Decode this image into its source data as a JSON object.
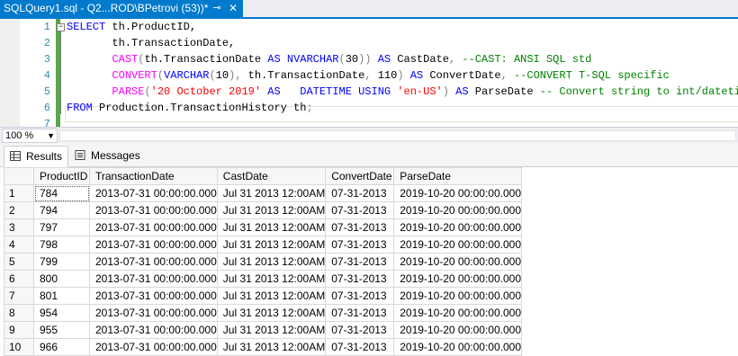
{
  "document_tab": {
    "title": "SQLQuery1.sql - Q2...ROD\\BPetrovi (53))*",
    "pin": "⊸",
    "close": "✕"
  },
  "editor": {
    "lines": [
      {
        "number": "1",
        "tokens": [
          {
            "t": "SELECT",
            "c": "kw"
          },
          {
            "t": " th.ProductID,",
            "c": "tx"
          }
        ]
      },
      {
        "number": "2",
        "tokens": [
          {
            "t": "       th.TransactionDate,",
            "c": "tx"
          }
        ]
      },
      {
        "number": "3",
        "tokens": [
          {
            "t": "       ",
            "c": "tx"
          },
          {
            "t": "CAST",
            "c": "fn"
          },
          {
            "t": "(",
            "c": "gy"
          },
          {
            "t": "th.TransactionDate ",
            "c": "tx"
          },
          {
            "t": "AS NVARCHAR",
            "c": "kw"
          },
          {
            "t": "(",
            "c": "gy"
          },
          {
            "t": "30",
            "c": "tx"
          },
          {
            "t": "))",
            "c": "gy"
          },
          {
            "t": " ",
            "c": "tx"
          },
          {
            "t": "AS",
            "c": "kw"
          },
          {
            "t": " CastDate",
            "c": "tx"
          },
          {
            "t": ", ",
            "c": "gy"
          },
          {
            "t": "--CAST: ANSI SQL std",
            "c": "cm"
          }
        ]
      },
      {
        "number": "4",
        "tokens": [
          {
            "t": "       ",
            "c": "tx"
          },
          {
            "t": "CONVERT",
            "c": "fn"
          },
          {
            "t": "(",
            "c": "gy"
          },
          {
            "t": "VARCHAR",
            "c": "kw"
          },
          {
            "t": "(",
            "c": "gy"
          },
          {
            "t": "10",
            "c": "tx"
          },
          {
            "t": "),",
            "c": "gy"
          },
          {
            "t": " th.TransactionDate",
            "c": "tx"
          },
          {
            "t": ",",
            "c": "gy"
          },
          {
            "t": " 110",
            "c": "tx"
          },
          {
            "t": ")",
            "c": "gy"
          },
          {
            "t": " ",
            "c": "tx"
          },
          {
            "t": "AS",
            "c": "kw"
          },
          {
            "t": " ConvertDate",
            "c": "tx"
          },
          {
            "t": ", ",
            "c": "gy"
          },
          {
            "t": "--CONVERT T-SQL specific",
            "c": "cm"
          }
        ]
      },
      {
        "number": "5",
        "tokens": [
          {
            "t": "       ",
            "c": "tx"
          },
          {
            "t": "PARSE",
            "c": "fn"
          },
          {
            "t": "(",
            "c": "gy"
          },
          {
            "t": "'20 October 2019'",
            "c": "str"
          },
          {
            "t": " ",
            "c": "tx"
          },
          {
            "t": "AS",
            "c": "kw"
          },
          {
            "t": "   ",
            "c": "tx"
          },
          {
            "t": "DATETIME USING",
            "c": "kw"
          },
          {
            "t": " ",
            "c": "tx"
          },
          {
            "t": "'en-US'",
            "c": "str"
          },
          {
            "t": ")",
            "c": "gy"
          },
          {
            "t": " ",
            "c": "tx"
          },
          {
            "t": "AS",
            "c": "kw"
          },
          {
            "t": " ParseDate ",
            "c": "tx"
          },
          {
            "t": "-- Convert string to int/datetime",
            "c": "cm"
          }
        ]
      },
      {
        "number": "6",
        "tokens": [
          {
            "t": "FROM",
            "c": "kw"
          },
          {
            "t": " Production.TransactionHistory th",
            "c": "tx"
          },
          {
            "t": ";",
            "c": "gy"
          }
        ]
      },
      {
        "number": "7",
        "tokens": []
      }
    ]
  },
  "zoom": {
    "value": "100 %"
  },
  "results_tabs": [
    {
      "label": "Results",
      "icon": "grid-icon"
    },
    {
      "label": "Messages",
      "icon": "messages-icon"
    }
  ],
  "grid": {
    "columns": [
      "ProductID",
      "TransactionDate",
      "CastDate",
      "ConvertDate",
      "ParseDate"
    ],
    "rows": [
      [
        "1",
        "784",
        "2013-07-31 00:00:00.000",
        "Jul 31 2013 12:00AM",
        "07-31-2013",
        "2019-10-20 00:00:00.000"
      ],
      [
        "2",
        "794",
        "2013-07-31 00:00:00.000",
        "Jul 31 2013 12:00AM",
        "07-31-2013",
        "2019-10-20 00:00:00.000"
      ],
      [
        "3",
        "797",
        "2013-07-31 00:00:00.000",
        "Jul 31 2013 12:00AM",
        "07-31-2013",
        "2019-10-20 00:00:00.000"
      ],
      [
        "4",
        "798",
        "2013-07-31 00:00:00.000",
        "Jul 31 2013 12:00AM",
        "07-31-2013",
        "2019-10-20 00:00:00.000"
      ],
      [
        "5",
        "799",
        "2013-07-31 00:00:00.000",
        "Jul 31 2013 12:00AM",
        "07-31-2013",
        "2019-10-20 00:00:00.000"
      ],
      [
        "6",
        "800",
        "2013-07-31 00:00:00.000",
        "Jul 31 2013 12:00AM",
        "07-31-2013",
        "2019-10-20 00:00:00.000"
      ],
      [
        "7",
        "801",
        "2013-07-31 00:00:00.000",
        "Jul 31 2013 12:00AM",
        "07-31-2013",
        "2019-10-20 00:00:00.000"
      ],
      [
        "8",
        "954",
        "2013-07-31 00:00:00.000",
        "Jul 31 2013 12:00AM",
        "07-31-2013",
        "2019-10-20 00:00:00.000"
      ],
      [
        "9",
        "955",
        "2013-07-31 00:00:00.000",
        "Jul 31 2013 12:00AM",
        "07-31-2013",
        "2019-10-20 00:00:00.000"
      ],
      [
        "10",
        "966",
        "2013-07-31 00:00:00.000",
        "Jul 31 2013 12:00AM",
        "07-31-2013",
        "2019-10-20 00:00:00.000"
      ]
    ]
  },
  "colors": {
    "accent": "#007acc",
    "keyword": "#0000ff",
    "function": "#ff00ff",
    "string": "#ff0000",
    "comment": "#008000",
    "line_number": "#2b91af"
  }
}
